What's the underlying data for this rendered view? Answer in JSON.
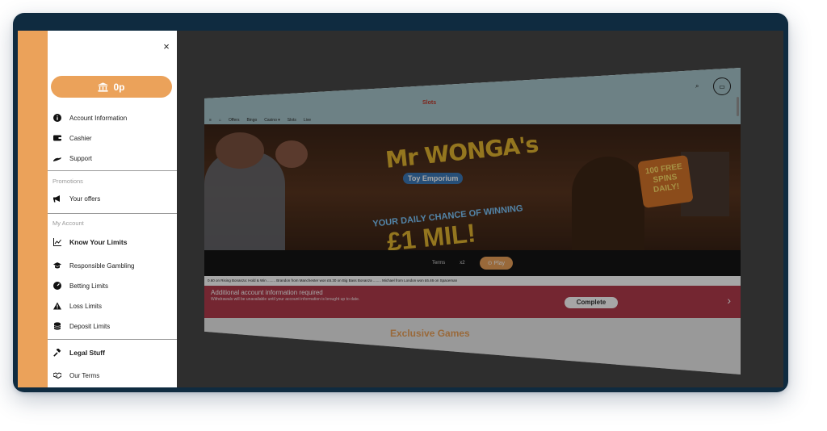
{
  "menu": {
    "close_label": "×",
    "balance": "0p",
    "items_top": [
      {
        "label": "Account Information",
        "icon": "info-icon"
      },
      {
        "label": "Cashier",
        "icon": "wallet-icon"
      },
      {
        "label": "Support",
        "icon": "support-icon"
      }
    ],
    "promotions": {
      "heading": "Promotions",
      "items": [
        {
          "label": "Your offers",
          "icon": "megaphone-icon"
        }
      ]
    },
    "my_account": {
      "heading": "My Account",
      "know_limits": "Know Your Limits",
      "items": [
        {
          "label": "Responsible Gambling",
          "icon": "graduation-cap-icon"
        },
        {
          "label": "Betting Limits",
          "icon": "gauge-icon"
        },
        {
          "label": "Loss Limits",
          "icon": "warning-icon"
        },
        {
          "label": "Deposit Limits",
          "icon": "coins-icon"
        }
      ]
    },
    "legal": {
      "heading": "Legal Stuff",
      "items": [
        {
          "label": "Our Terms",
          "icon": "handshake-icon"
        }
      ]
    }
  },
  "site": {
    "logo": "Slots",
    "nav": [
      "≡",
      "⌂",
      "Offers",
      "Bingo",
      "Casino ▾",
      "Slots",
      "Live"
    ],
    "banner": {
      "title_top": "Mr WONGA's",
      "title_sub": "Toy Emporium",
      "tagline": "YOUR DAILY CHANCE OF WINNING",
      "prize": "£1 MIL!",
      "spins": "100 FREE SPINS DAILY!",
      "terms": "Terms",
      "counter": "x2",
      "play": "⊙ Play"
    },
    "ticker": "0.60 on Rising Bonanza: Hold & Win ........ Brandon from Manchester won £6.30 on Big Bass Bonanza ........ Michael from London won £6.46 on Spaceman",
    "alert": {
      "title": "Additional account information required",
      "subtitle": "Withdrawals will be unavailable until your account information is brought up to date.",
      "button": "Complete",
      "chevron": "›"
    },
    "section_heading": "Exclusive Games"
  },
  "colors": {
    "accent": "#eba25a",
    "frame": "#0f2b40",
    "alert": "#b23b4c"
  }
}
